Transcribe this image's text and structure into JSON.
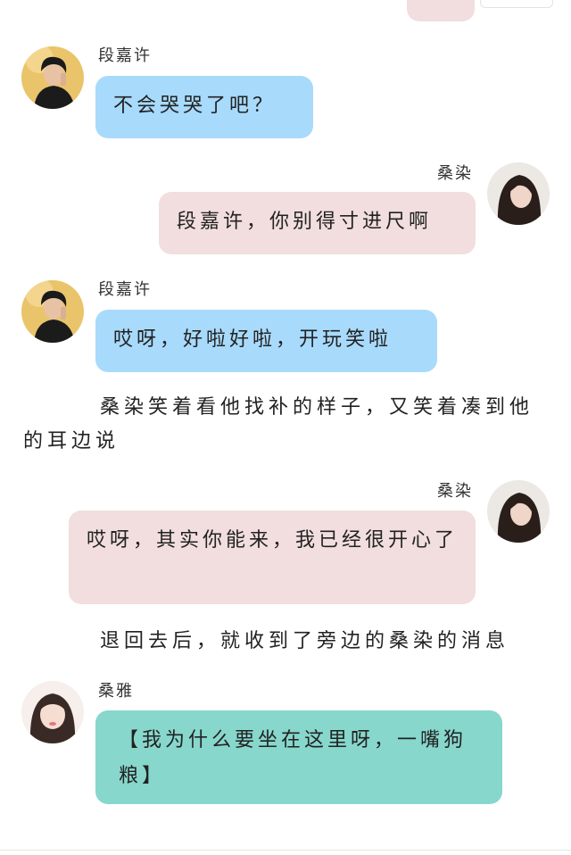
{
  "messages": [
    {
      "sender": "段嘉许",
      "text": "不会哭哭了吧？"
    },
    {
      "sender": "桑染",
      "text": "段嘉许，你别得寸进尺啊"
    },
    {
      "sender": "段嘉许",
      "text": "哎呀，好啦好啦，开玩笑啦"
    },
    {
      "sender": "桑染",
      "text": "哎呀，其实你能来，我已经很开心了"
    },
    {
      "sender": "桑雅",
      "text": "【我为什么要坐在这里呀，一嘴狗粮】"
    }
  ],
  "narration": [
    "桑染笑着看他找补的样子，又笑着凑到他的耳边说",
    "退回去后，就收到了旁边的桑染的消息"
  ],
  "colors": {
    "bubble_blue": "#a8dafc",
    "bubble_pink": "#f2dede",
    "bubble_teal": "#87d7cc"
  }
}
